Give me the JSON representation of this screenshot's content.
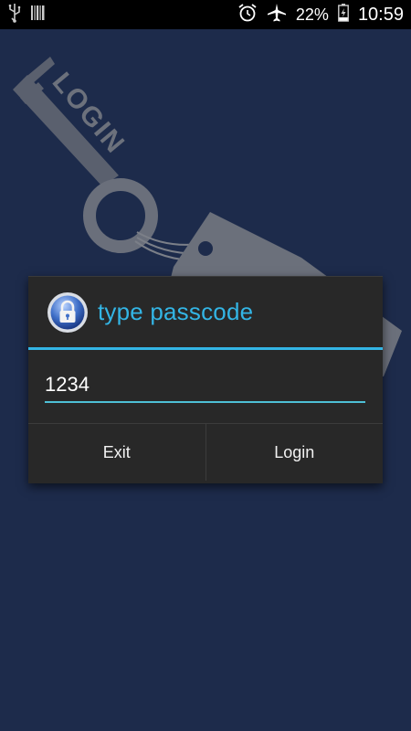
{
  "status_bar": {
    "battery_percent": "22%",
    "time": "10:59",
    "icons_left": [
      "usb-icon",
      "barcode-icon"
    ],
    "icons_right": [
      "alarm-icon",
      "airplane-icon",
      "battery-icon"
    ]
  },
  "background": {
    "key_text": "LOGIN"
  },
  "dialog": {
    "title": "type passcode",
    "icon": "lock-icon",
    "passcode_value": "1234",
    "buttons": {
      "exit": "Exit",
      "login": "Login"
    }
  },
  "colors": {
    "background": "#1d2b4b",
    "dialog": "#282828",
    "accent": "#33b5e5"
  }
}
